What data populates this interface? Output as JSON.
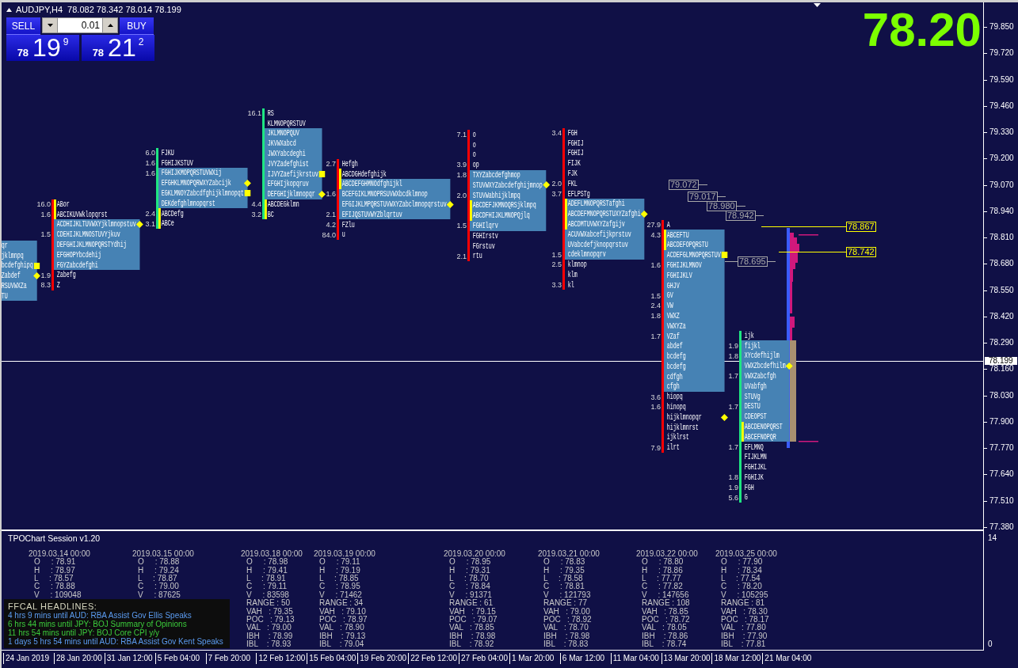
{
  "window": {
    "symbol": "AUDJPY,H4",
    "ohlc": "78.082 78.342 78.014 78.199"
  },
  "trade_panel": {
    "sell": {
      "label": "SELL",
      "prefix": "78",
      "pips": "19",
      "fraction": "9"
    },
    "lot": "0.01",
    "buy": {
      "label": "BUY",
      "prefix": "78",
      "pips": "21",
      "fraction": "2"
    }
  },
  "last_price": "78.20",
  "price_axis": {
    "labels": [
      "79.850",
      "79.720",
      "79.590",
      "79.460",
      "79.330",
      "79.200",
      "79.070",
      "78.940",
      "78.810",
      "78.680",
      "78.550",
      "78.420",
      "78.290",
      "78.160",
      "78.030",
      "77.900",
      "77.770",
      "77.640",
      "77.510",
      "77.380"
    ],
    "current": "78.199"
  },
  "profiles": [
    {
      "rows": [
        {
          "kind": "plain",
          "tpo": "qr",
          "value_area": true
        },
        {
          "kind": "plain",
          "tpo": "jklmnpq",
          "value_area": true
        },
        {
          "kind": "square",
          "tpo": "bcdefghipq",
          "value_area": true
        },
        {
          "kind": "diamond",
          "tpo": "Zabdef",
          "value_area": true
        },
        {
          "kind": "plain",
          "tpo": "RSUVWXZa",
          "value_area": true
        },
        {
          "kind": "plain",
          "tpo": "TU",
          "value_area": true
        }
      ]
    },
    {
      "color": "#ff0000",
      "rows": [
        {
          "kind": "plain",
          "tpo": "ABor",
          "volume": "16.0",
          "value_area": false,
          "initial_balance": true
        },
        {
          "kind": "plain",
          "tpo": "ABCIKUVWklopqrst",
          "volume": "1.6",
          "value_area": false,
          "initial_balance": true
        },
        {
          "kind": "diamond",
          "tpo": "ACDHIJKLTUVWXYjklmnopstuv",
          "value_area": true,
          "initial_balance": false
        },
        {
          "kind": "plain",
          "tpo": "CDEHIJKLMNOSTUVYjkuv",
          "volume": "1.5",
          "value_area": true,
          "initial_balance": false
        },
        {
          "kind": "plain",
          "tpo": "DEFGHIJKLMNOPQRSTYdhij",
          "value_area": true,
          "initial_balance": false
        },
        {
          "kind": "plain",
          "tpo": "EFGHOPYbcdehij",
          "value_area": true,
          "initial_balance": false
        },
        {
          "kind": "plain",
          "tpo": "FGYZabcdefghi",
          "value_area": true,
          "initial_balance": false
        },
        {
          "kind": "plain",
          "tpo": "Zabefg",
          "volume": "1.9",
          "value_area": false,
          "initial_balance": false
        },
        {
          "kind": "plain",
          "tpo": "Z",
          "volume": "8.3",
          "value_area": false,
          "initial_balance": false
        }
      ]
    },
    {
      "color": "#1ee682",
      "rows": [
        {
          "kind": "plain",
          "tpo": "FJKU",
          "volume": "6.0",
          "value_area": false,
          "initial_balance": false
        },
        {
          "kind": "plain",
          "tpo": "FGHIJKSTUV",
          "volume": "1.6",
          "value_area": false,
          "initial_balance": false
        },
        {
          "kind": "plain",
          "tpo": "FGHIJKMOPQRSTUVWXij",
          "volume": "1.6",
          "value_area": true,
          "initial_balance": false
        },
        {
          "kind": "diamond",
          "tpo": "EFGHKLMNOPQRWXYZabcijk",
          "value_area": true,
          "initial_balance": false
        },
        {
          "kind": "square",
          "tpo": "EGKLMNOYZabcdfghijklmnopqt",
          "value_area": true,
          "initial_balance": false
        },
        {
          "kind": "plain",
          "tpo": "DEKdefghlmnopqrst",
          "value_area": true,
          "initial_balance": false
        },
        {
          "kind": "plain",
          "tpo": "ABCDefg",
          "volume": "2.4",
          "value_area": false,
          "initial_balance": true
        },
        {
          "kind": "plain",
          "tpo": "ABCe",
          "volume": "3.1",
          "value_area": false,
          "initial_balance": true
        }
      ]
    },
    {
      "color": "#1ee682",
      "rows": [
        {
          "kind": "plain",
          "tpo": "RS",
          "volume": "16.1",
          "value_area": false,
          "initial_balance": false
        },
        {
          "kind": "plain",
          "tpo": "KLMNOPQRSTUV",
          "value_area": false,
          "initial_balance": false
        },
        {
          "kind": "plain",
          "tpo": "JKLMNOPQUV",
          "value_area": true,
          "initial_balance": false
        },
        {
          "kind": "plain",
          "tpo": "JKVWXabcd",
          "value_area": true,
          "initial_balance": false
        },
        {
          "kind": "plain",
          "tpo": "JWXYabcdeghi",
          "value_area": true,
          "initial_balance": false
        },
        {
          "kind": "plain",
          "tpo": "JVYZadefghist",
          "value_area": true,
          "initial_balance": false
        },
        {
          "kind": "square",
          "tpo": "IJVYZaefijkrstuv",
          "value_area": true,
          "initial_balance": false
        },
        {
          "kind": "plain",
          "tpo": "EFGHIjkopqruv",
          "value_area": true,
          "initial_balance": false
        },
        {
          "kind": "diamond",
          "tpo": "DEFGHIjklmnopqr",
          "value_area": true,
          "initial_balance": false
        },
        {
          "kind": "plain",
          "tpo": "ABCDEGklmn",
          "volume": "4.4",
          "value_area": false,
          "initial_balance": true
        },
        {
          "kind": "plain",
          "tpo": "BC",
          "volume": "3.2",
          "value_area": false,
          "initial_balance": true
        }
      ]
    },
    {
      "color": "#ff0000",
      "rows": [
        {
          "kind": "plain",
          "tpo": "Hefgh",
          "volume": "2.7",
          "value_area": false,
          "initial_balance": false
        },
        {
          "kind": "plain",
          "tpo": "ABCDGHdefghijk",
          "value_area": false,
          "initial_balance": true
        },
        {
          "kind": "plain",
          "tpo": "ABCDEFGHMNOdfghijkl",
          "value_area": true,
          "initial_balance": true
        },
        {
          "kind": "plain",
          "tpo": "BCEFGIKLMNOPRSUVWXbcdklmnop",
          "volume": "1.6",
          "value_area": true,
          "initial_balance": false
        },
        {
          "kind": "diamond",
          "tpo": "EFGIJKLMPQRSTUVWXYZabclmnopqrstuv",
          "value_area": true,
          "initial_balance": false
        },
        {
          "kind": "plain",
          "tpo": "EFIJQSTUVWYZblqrtuv",
          "volume": "2.1",
          "value_area": true,
          "initial_balance": false
        },
        {
          "kind": "plain",
          "tpo": "FZlu",
          "volume": "4.2",
          "value_area": false,
          "initial_balance": false
        },
        {
          "kind": "plain",
          "tpo": "u",
          "volume": "84.0",
          "value_area": false,
          "initial_balance": false
        }
      ]
    },
    {
      "color": "#ff0000",
      "rows": [
        {
          "kind": "plain",
          "tpo": "o",
          "volume": "7.1",
          "value_area": false,
          "initial_balance": false
        },
        {
          "kind": "plain",
          "tpo": "o",
          "value_area": false,
          "initial_balance": false
        },
        {
          "kind": "plain",
          "tpo": "o",
          "value_area": false,
          "initial_balance": false
        },
        {
          "kind": "plain",
          "tpo": "op",
          "volume": "3.9",
          "value_area": false,
          "initial_balance": false
        },
        {
          "kind": "plain",
          "tpo": "TXYZabcdefghmop",
          "volume": "1.8",
          "value_area": true,
          "initial_balance": false
        },
        {
          "kind": "diamond",
          "tpo": "STUVWXYZabcdefghijmnop",
          "value_area": true,
          "initial_balance": false
        },
        {
          "kind": "plain",
          "tpo": "STUVWabhijklmpq",
          "volume": "2.0",
          "value_area": true,
          "initial_balance": false
        },
        {
          "kind": "plain",
          "tpo": "ABCDEFJKMNOQRSjklmpq",
          "value_area": true,
          "initial_balance": true
        },
        {
          "kind": "plain",
          "tpo": "ABCDFHIJKLMNOPQjlq",
          "value_area": true,
          "initial_balance": true
        },
        {
          "kind": "plain",
          "tpo": "FGHIlqrv",
          "volume": "1.5",
          "value_area": true,
          "initial_balance": false
        },
        {
          "kind": "plain",
          "tpo": "FGHIrstv",
          "value_area": false,
          "initial_balance": false
        },
        {
          "kind": "plain",
          "tpo": "FGrstuv",
          "value_area": false,
          "initial_balance": false
        },
        {
          "kind": "plain",
          "tpo": "rtu",
          "volume": "2.1",
          "value_area": false,
          "initial_balance": false
        }
      ]
    },
    {
      "color": "#ff0000",
      "rows": [
        {
          "kind": "plain",
          "tpo": "FGH",
          "volume": "3.4",
          "value_area": false,
          "initial_balance": false
        },
        {
          "kind": "plain",
          "tpo": "FGHIJ",
          "value_area": false,
          "initial_balance": false
        },
        {
          "kind": "plain",
          "tpo": "FGHIJ",
          "value_area": false,
          "initial_balance": false
        },
        {
          "kind": "plain",
          "tpo": "FIJK",
          "value_area": false,
          "initial_balance": false
        },
        {
          "kind": "plain",
          "tpo": "FJK",
          "value_area": false,
          "initial_balance": false
        },
        {
          "kind": "plain",
          "tpo": "FKL",
          "volume": "2.0",
          "value_area": false,
          "initial_balance": false
        },
        {
          "kind": "plain",
          "tpo": "EFLPSTg",
          "volume": "3.7",
          "value_area": false,
          "initial_balance": false
        },
        {
          "kind": "plain",
          "tpo": "ADEFLMNOPQRSTafghi",
          "value_area": true,
          "initial_balance": true
        },
        {
          "kind": "diamond",
          "tpo": "ABCDEFMNOPQRSTUXYZafghi",
          "value_area": true,
          "initial_balance": true
        },
        {
          "kind": "plain",
          "tpo": "ABCDMTUVWXYZafgijv",
          "value_area": true,
          "initial_balance": true
        },
        {
          "kind": "plain",
          "tpo": "ACUVWXabcefijkprstuv",
          "value_area": true,
          "initial_balance": false
        },
        {
          "kind": "plain",
          "tpo": "UVabcdefjknopqrstuv",
          "value_area": true,
          "initial_balance": false
        },
        {
          "kind": "plain",
          "tpo": "cdeklmnopqrv",
          "volume": "1.5",
          "value_area": true,
          "initial_balance": false
        },
        {
          "kind": "plain",
          "tpo": "klmnop",
          "volume": "2.5",
          "value_area": false,
          "initial_balance": false
        },
        {
          "kind": "plain",
          "tpo": "klm",
          "value_area": false,
          "initial_balance": false
        },
        {
          "kind": "plain",
          "tpo": "kl",
          "volume": "3.3",
          "value_area": false,
          "initial_balance": false
        }
      ]
    },
    {
      "color": "#ff0000",
      "rows": [
        {
          "kind": "plain",
          "tpo": "A",
          "volume": "27.9",
          "value_area": false,
          "initial_balance": false
        },
        {
          "kind": "plain",
          "tpo": "ABCEFTU",
          "volume": "4.3",
          "value_area": true,
          "initial_balance": true
        },
        {
          "kind": "plain",
          "tpo": "ABCDEFOPQRSTU",
          "value_area": true,
          "initial_balance": true
        },
        {
          "kind": "square",
          "tpo": "ACDEFGLMNOPQRSTUV",
          "value_area": true,
          "initial_balance": false
        },
        {
          "kind": "plain",
          "tpo": "FGHIJKLMNOV",
          "volume": "1.6",
          "value_area": true,
          "initial_balance": false
        },
        {
          "kind": "plain",
          "tpo": "FGHIJKLV",
          "value_area": true,
          "initial_balance": false
        },
        {
          "kind": "plain",
          "tpo": "GHJV",
          "value_area": true,
          "initial_balance": false
        },
        {
          "kind": "plain",
          "tpo": "GV",
          "volume": "1.5",
          "value_area": true,
          "initial_balance": false
        },
        {
          "kind": "plain",
          "tpo": "VW",
          "volume": "2.4",
          "value_area": true,
          "initial_balance": false
        },
        {
          "kind": "plain",
          "tpo": "VWXZ",
          "volume": "1.8",
          "value_area": true,
          "initial_balance": false
        },
        {
          "kind": "plain",
          "tpo": "VWXYZa",
          "value_area": true,
          "initial_balance": false
        },
        {
          "kind": "plain",
          "tpo": "VZaf",
          "volume": "1.7",
          "value_area": true,
          "initial_balance": false
        },
        {
          "kind": "plain",
          "tpo": "abdef",
          "value_area": true,
          "initial_balance": false
        },
        {
          "kind": "plain",
          "tpo": "bcdefg",
          "value_area": true,
          "initial_balance": false
        },
        {
          "kind": "plain",
          "tpo": "bcdefg",
          "value_area": true,
          "initial_balance": false
        },
        {
          "kind": "plain",
          "tpo": "cdfgh",
          "value_area": true,
          "initial_balance": false
        },
        {
          "kind": "plain",
          "tpo": "cfgh",
          "value_area": true,
          "initial_balance": false
        },
        {
          "kind": "plain",
          "tpo": "hiopq",
          "volume": "3.6",
          "value_area": false,
          "initial_balance": false
        },
        {
          "kind": "plain",
          "tpo": "hinopq",
          "volume": "1.6",
          "value_area": false,
          "initial_balance": false
        },
        {
          "kind": "diamond",
          "tpo": "hijklmnopqr",
          "value_area": false,
          "initial_balance": false
        },
        {
          "kind": "plain",
          "tpo": "hijklmnrst",
          "value_area": false,
          "initial_balance": false
        },
        {
          "kind": "plain",
          "tpo": "ijklrst",
          "value_area": false,
          "initial_balance": false
        },
        {
          "kind": "plain",
          "tpo": "ilrt",
          "volume": "7.9",
          "value_area": false,
          "initial_balance": false
        }
      ]
    },
    {
      "color": "#1ee682",
      "rows": [
        {
          "kind": "plain",
          "tpo": "ijk",
          "value_area": false,
          "initial_balance": false
        },
        {
          "kind": "plain",
          "tpo": "fijkl",
          "volume": "1.9",
          "value_area": true,
          "initial_balance": false
        },
        {
          "kind": "plain",
          "tpo": "XYcdefhijlm",
          "volume": "1.8",
          "value_area": true,
          "initial_balance": false
        },
        {
          "kind": "diamond",
          "tpo": "VWXZbcdefhilm",
          "value_area": true,
          "initial_balance": false
        },
        {
          "kind": "plain",
          "tpo": "VWXZabcfgh",
          "volume": "1.7",
          "value_area": true,
          "initial_balance": false
        },
        {
          "kind": "plain",
          "tpo": "UVabfgh",
          "value_area": true,
          "initial_balance": false
        },
        {
          "kind": "plain",
          "tpo": "STUVg",
          "value_area": true,
          "initial_balance": false
        },
        {
          "kind": "plain",
          "tpo": "DESTU",
          "volume": "1.7",
          "value_area": true,
          "initial_balance": false
        },
        {
          "kind": "plain",
          "tpo": "CDEOPST",
          "value_area": true,
          "initial_balance": false
        },
        {
          "kind": "plain",
          "tpo": "ABCDENOPQRST",
          "value_area": true,
          "initial_balance": true
        },
        {
          "kind": "plain",
          "tpo": "ABCEFNOPQR",
          "value_area": true,
          "initial_balance": true
        },
        {
          "kind": "plain",
          "tpo": "EFLMNQ",
          "volume": "1.7",
          "value_area": false,
          "initial_balance": false
        },
        {
          "kind": "plain",
          "tpo": "FIJKLMN",
          "value_area": false,
          "initial_balance": false
        },
        {
          "kind": "plain",
          "tpo": "FGHIJKL",
          "value_area": false,
          "initial_balance": false
        },
        {
          "kind": "plain",
          "tpo": "FGHIJK",
          "volume": "1.8",
          "value_area": false,
          "initial_balance": false
        },
        {
          "kind": "plain",
          "tpo": "FGH",
          "volume": "1.9",
          "value_area": false,
          "initial_balance": false
        },
        {
          "kind": "plain",
          "tpo": "G",
          "volume": "5.6",
          "value_area": false,
          "initial_balance": false
        }
      ]
    }
  ],
  "price_labels": [
    {
      "text": "79.072",
      "color": "#a9a9a9"
    },
    {
      "text": "79.017",
      "color": "#a9a9a9"
    },
    {
      "text": "78.980",
      "color": "#a9a9a9"
    },
    {
      "text": "78.942",
      "color": "#a9a9a9"
    },
    {
      "text": "78.695",
      "color": "#a9a9a9"
    },
    {
      "text": "78.867",
      "color": "#ffff00"
    },
    {
      "text": "78.742",
      "color": "#ffff00"
    }
  ],
  "indicator": {
    "title": "TPOChart Session v1.20",
    "axis": [
      "14",
      "0"
    ],
    "sessions": [
      {
        "date": "2019.03.14 00:00",
        "lines": [
          "O     : 78.91",
          "H     : 78.97",
          "L     : 78.57",
          "C     : 78.88",
          "V     : 109048"
        ]
      },
      {
        "date": "2019.03.15 00:00",
        "lines": [
          "O     : 78.88",
          "H     : 79.24",
          "L     : 78.87",
          "C     : 79.00",
          "V     : 87625"
        ]
      },
      {
        "date": "2019.03.18 00:00",
        "lines": [
          "O     : 78.98",
          "H     : 79.41",
          "L     : 78.91",
          "C     : 79.11",
          "V     : 83598",
          "RANGE : 50",
          "VAH   : 79.35",
          "POC   : 79.13",
          "VAL   : 79.00",
          "IBH    : 78.99",
          "IBL    : 78.93"
        ]
      },
      {
        "date": "2019.03.19 00:00",
        "lines": [
          "O     : 79.11",
          "H     : 79.19",
          "L     : 78.85",
          "C     : 78.95",
          "V     : 71462",
          "RANGE : 34",
          "VAH   : 79.10",
          "POC   : 78.97",
          "VAL   : 78.90",
          "IBH    : 79.13",
          "IBL    : 79.04"
        ]
      },
      {
        "date": "2019.03.20 00:00",
        "lines": [
          "O     : 78.95",
          "H     : 79.31",
          "L     : 78.70",
          "C     : 78.84",
          "V     : 91371",
          "RANGE : 61",
          "VAH   : 79.15",
          "POC   : 79.07",
          "VAL   : 78.85",
          "IBH    : 78.98",
          "IBL    : 78.92"
        ]
      },
      {
        "date": "2019.03.21 00:00",
        "lines": [
          "O     : 78.83",
          "H     : 79.35",
          "L     : 78.58",
          "C     : 78.81",
          "V     : 121793",
          "RANGE : 77",
          "VAH   : 79.00",
          "POC   : 78.92",
          "VAL   : 78.70",
          "IBH    : 78.98",
          "IBL    : 78.83"
        ]
      },
      {
        "date": "2019.03.22 00:00",
        "lines": [
          "O     : 78.80",
          "H     : 78.86",
          "L     : 77.77",
          "C     : 77.82",
          "V     : 147656",
          "RANGE : 108",
          "VAH   : 78.85",
          "POC   : 78.72",
          "VAL   : 78.05",
          "IBH    : 78.86",
          "IBL    : 78.74"
        ]
      },
      {
        "date": "2019.03.25 00:00",
        "lines": [
          "O     : 77.90",
          "H     : 78.34",
          "L     : 77.54",
          "C     : 78.20",
          "V     : 105295",
          "RANGE : 81",
          "VAH   : 78.30",
          "POC   : 78.17",
          "VAL   : 77.80",
          "IBH    : 77.90",
          "IBL    : 77.81"
        ]
      }
    ],
    "headlines": {
      "title": "FFCAL HEADLINES:",
      "items": [
        {
          "text": "4 hrs 9 mins until AUD: RBA Assist Gov Ellis Speaks",
          "color": "#5b9bf0"
        },
        {
          "text": "6 hrs 44 mins until JPY: BOJ Summary of Opinions",
          "color": "#3ccc3c"
        },
        {
          "text": "11 hrs 54 mins until JPY: BOJ Core CPI y/y",
          "color": "#3ccc3c"
        },
        {
          "text": "1 days 5 hrs 54 mins until AUD: RBA Assist Gov Kent Speaks",
          "color": "#5b9bf0"
        }
      ]
    }
  },
  "time_axis": [
    "24 Jan 2019",
    "28 Jan 20:00",
    "31 Jan 12:00",
    "5 Feb 04:00",
    "7 Feb 20:00",
    "12 Feb 12:00",
    "15 Feb 04:00",
    "19 Feb 20:00",
    "22 Feb 12:00",
    "27 Feb 04:00",
    "1 Mar 20:00",
    "6 Mar 12:00",
    "11 Mar 04:00",
    "13 Mar 20:00",
    "18 Mar 12:00",
    "21 Mar 04:00"
  ]
}
